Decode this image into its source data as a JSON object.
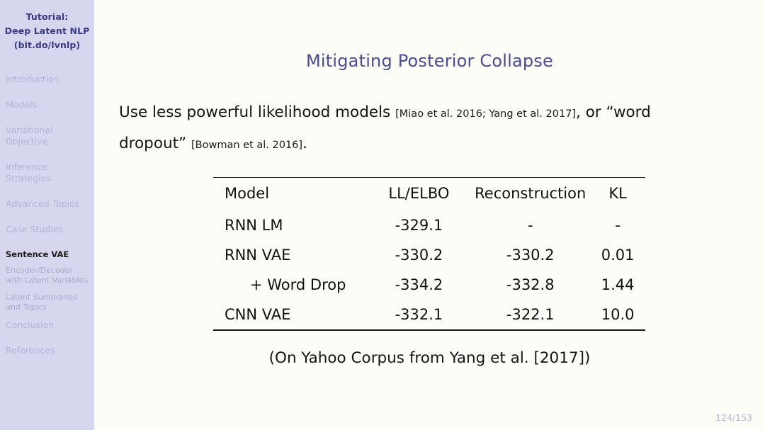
{
  "sidebar": {
    "title_lines": [
      "Tutorial:",
      "Deep Latent NLP",
      "(bit.do/lvnlp)"
    ],
    "items": [
      {
        "label": "Introduction",
        "level": "section",
        "active": false
      },
      {
        "label": "Models",
        "level": "section",
        "active": false
      },
      {
        "label": "Variational Objective",
        "level": "section",
        "active": false
      },
      {
        "label": "Inference Strategies",
        "level": "section",
        "active": false
      },
      {
        "label": "Advanced Topics",
        "level": "section",
        "active": false
      },
      {
        "label": "Case Studies",
        "level": "section",
        "active": false
      },
      {
        "label": "Sentence VAE",
        "level": "subsection",
        "active": true
      },
      {
        "label": "Encoder/Decoder with Latent Variables",
        "level": "subsection",
        "active": false
      },
      {
        "label": "Latent Summaries and Topics",
        "level": "subsection",
        "active": false
      },
      {
        "label": "Conclusion",
        "level": "section",
        "active": false
      },
      {
        "label": "References",
        "level": "section",
        "active": false
      }
    ],
    "colors": {
      "background": "#d6d6ef",
      "title": "#3b3b8c",
      "inactive": "#b3b3d6",
      "active": "#1a1a1a"
    }
  },
  "slide": {
    "title": "Mitigating Posterior Collapse",
    "title_color": "#4a4a99",
    "body": {
      "segment_1": "Use less powerful likelihood models ",
      "citation_1": "[Miao et al. 2016; Yang et al. 2017]",
      "segment_2": ", or “word dropout” ",
      "citation_2": "[Bowman et al. 2016]",
      "segment_3": "."
    },
    "caption": "(On Yahoo Corpus from Yang et al. [2017])",
    "page_number": "124/153"
  },
  "chart_data": {
    "type": "table",
    "title": "Mitigating Posterior Collapse",
    "columns": [
      "Model",
      "LL/ELBO",
      "Reconstruction",
      "KL"
    ],
    "rows": [
      {
        "model": "RNN LM",
        "indent": false,
        "ll_elbo": "-329.1",
        "reconstruction": "-",
        "kl": "-"
      },
      {
        "model": "RNN VAE",
        "indent": false,
        "ll_elbo": "-330.2",
        "reconstruction": "-330.2",
        "kl": "0.01"
      },
      {
        "model": "+ Word Drop",
        "indent": true,
        "ll_elbo": "-334.2",
        "reconstruction": "-332.8",
        "kl": "1.44"
      },
      {
        "model": "CNN VAE",
        "indent": false,
        "ll_elbo": "-332.1",
        "reconstruction": "-322.1",
        "kl": "10.0"
      }
    ],
    "caption": "(On Yahoo Corpus from Yang et al. [2017])"
  }
}
